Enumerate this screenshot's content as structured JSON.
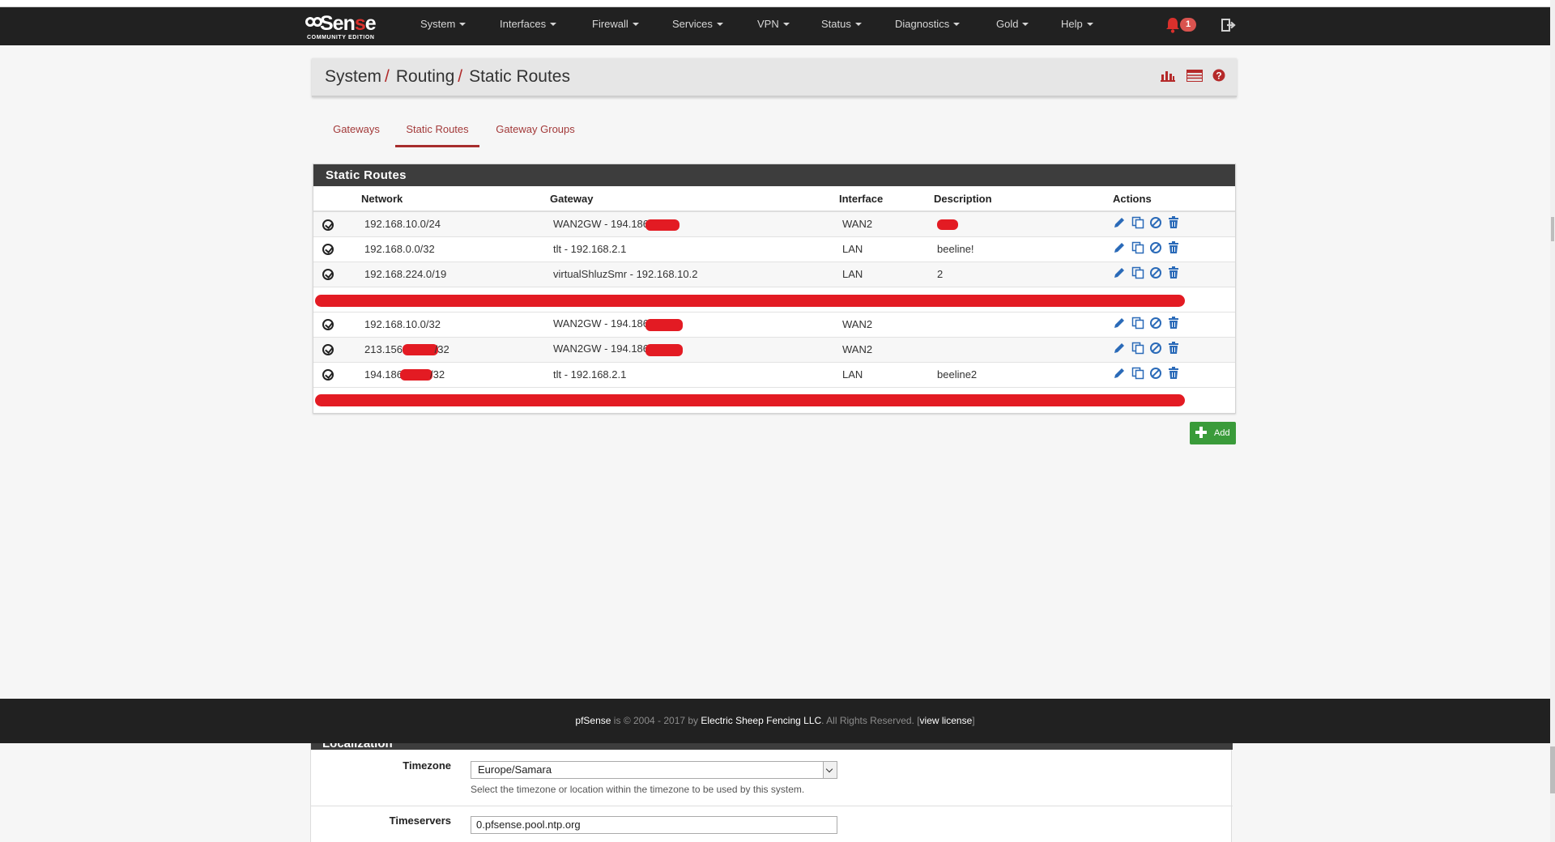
{
  "nav": {
    "brand_main": "Sen e",
    "brand_sub": "COMMUNITY EDITION",
    "menus": [
      "System",
      "Interfaces",
      "Firewall",
      "Services",
      "VPN",
      "Status",
      "Diagnostics",
      "Gold",
      "Help"
    ],
    "notification_count": "1"
  },
  "breadcrumb": {
    "items": [
      "System",
      "Routing",
      "Static Routes"
    ],
    "separator": "/"
  },
  "tabs": [
    {
      "label": "Gateways",
      "active": false
    },
    {
      "label": "Static Routes",
      "active": true
    },
    {
      "label": "Gateway Groups",
      "active": false
    }
  ],
  "panel": {
    "title": "Static Routes",
    "columns": [
      "Network",
      "Gateway",
      "Interface",
      "Description",
      "Actions"
    ],
    "rows": [
      {
        "network": "192.168.10.0/24",
        "gateway": "WAN2GW - 194.186",
        "interface": "WAN2",
        "description": ""
      },
      {
        "network": "192.168.0.0/32",
        "gateway": "tlt - 192.168.2.1",
        "interface": "LAN",
        "description": "beeline!"
      },
      {
        "network": "192.168.224.0/19",
        "gateway": "virtualShluzSmr - 192.168.10.2",
        "interface": "LAN",
        "description": "2"
      },
      {
        "network": "192.168.10.0/32",
        "gateway": "WAN2GW - 194.186",
        "interface": "WAN2",
        "description": ""
      },
      {
        "network_prefix": "213.156.",
        "network_suffix": "/32",
        "gateway": "WAN2GW - 194.186",
        "interface": "WAN2",
        "description": ""
      },
      {
        "network_prefix": "194.186",
        "network_suffix": "/32",
        "gateway": "tlt - 192.168.2.1",
        "interface": "LAN",
        "description": "beeline2"
      }
    ]
  },
  "add_button": "Add",
  "footer": {
    "brand": "pfSense",
    "is": "is",
    "copyright": "© 2004 - 2017 by",
    "company": "Electric Sheep Fencing LLC",
    "rights": ". All Rights Reserved. [",
    "license": "view license",
    "close": "]"
  },
  "general": {
    "section_title": "Localization",
    "timezone_label": "Timezone",
    "timezone_value": "Europe/Samara",
    "timezone_help": "Select the timezone or location within the timezone to be used by this system.",
    "timeservers_label": "Timeservers",
    "timeservers_value": "0.pfsense.pool.ntp.org"
  },
  "colors": {
    "navbar": "#212121",
    "accent_red": "#a72d2d",
    "action_blue": "#2a6ab8",
    "add_green": "#3a9b3a",
    "redaction": "#e31b23"
  }
}
